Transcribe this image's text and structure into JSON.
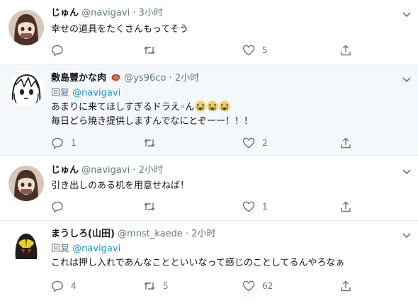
{
  "tweets": [
    {
      "name": "じゅん",
      "handle": "@navigavi",
      "dot": "·",
      "time": "3小时",
      "text_lines": [
        "幸せの道具をたくさんもってそう"
      ],
      "reply_count": "",
      "retweet_count": "",
      "like_count": "5"
    },
    {
      "name": "敷島豐かな肉",
      "handle": "@ys96co",
      "dot": "·",
      "time": "2小时",
      "reply_prefix": "回复",
      "reply_to": "@navigavi",
      "text_lines": [
        "あまりに来てほしすぎるドラえ◦ん",
        "毎日どら焼き提供しますんでなにとぞーー！！！"
      ],
      "reply_count": "1",
      "retweet_count": "",
      "like_count": "2"
    },
    {
      "name": "じゅん",
      "handle": "@navigavi",
      "dot": "·",
      "time": "2小时",
      "text_lines": [
        "引き出しのある机を用意せねば！"
      ],
      "reply_count": "",
      "retweet_count": "",
      "like_count": "1"
    },
    {
      "name": "まうしろ(山田)",
      "handle": "@mnst_kaede",
      "dot": "·",
      "time": "2小时",
      "reply_prefix": "回复",
      "reply_to": "@navigavi",
      "text_lines": [
        "これは押し入れであんなことといいなって感じのことしてるんやろなぁ"
      ],
      "reply_count": "4",
      "retweet_count": "5",
      "like_count": "62"
    }
  ],
  "colors": {
    "muted": "#657786",
    "link": "#1b95e0",
    "highlight_bg": "#f5f8fa"
  }
}
